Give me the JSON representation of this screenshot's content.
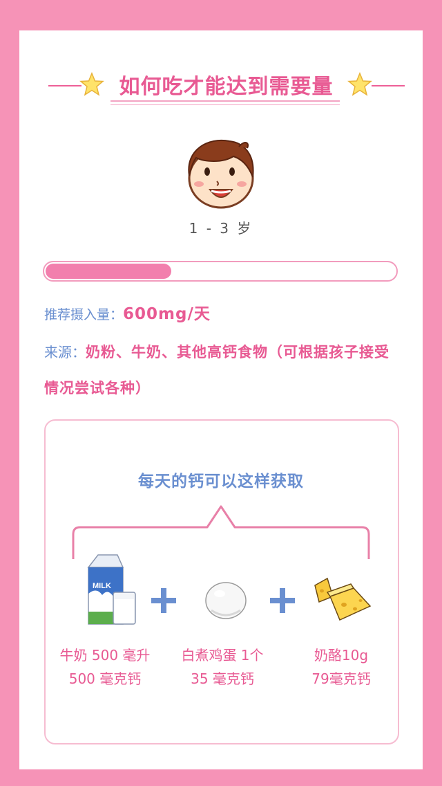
{
  "header": {
    "title": "如何吃才能达到需要量"
  },
  "child": {
    "age": "1 - 3 岁"
  },
  "progress": {
    "fraction": 0.36
  },
  "intake": {
    "label": "推荐摄入量：",
    "value": "600mg/天"
  },
  "source": {
    "label": "来源：",
    "value": "奶粉、牛奶、其他高钙食物（可根据孩子接受情况尝试各种）"
  },
  "daily": {
    "title": "每天的钙可以这样获取",
    "items": [
      {
        "icon": "milk-carton-glass-icon",
        "line1": "牛奶 500 毫升",
        "line2": "500 毫克钙"
      },
      {
        "icon": "boiled-egg-icon",
        "line1": "白煮鸡蛋 1个",
        "line2": "35 毫克钙"
      },
      {
        "icon": "cheese-icon",
        "line1": "奶酪10g",
        "line2": "79毫克钙"
      }
    ]
  },
  "colors": {
    "background": "#f693b7",
    "accent_pink": "#e85a93",
    "accent_blue": "#6a8fd0"
  }
}
